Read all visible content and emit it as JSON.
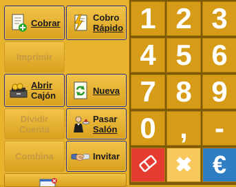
{
  "actions": {
    "cobrar": {
      "label": "Cobrar",
      "icon": "document-plus-icon"
    },
    "cobro_rapido": {
      "line1": "Cobro",
      "line2": "Rápido",
      "icon": "lightning-document-icon"
    },
    "imprimir": {
      "label": "Imprimir"
    },
    "abrir_cajon": {
      "line1": "Abrir",
      "line2": "Cajón",
      "icon": "cash-drawer-icon"
    },
    "nueva": {
      "label": "Nueva",
      "icon": "refresh-document-icon"
    },
    "dividir_cuenta": {
      "line1": "Dividir",
      "line2": "Cuenta"
    },
    "pasar_salon": {
      "line1": "Pasar",
      "line2": "Salón",
      "icon": "waiter-icon"
    },
    "combina": {
      "label": "Combina"
    },
    "invitar": {
      "label": "Invitar",
      "icon": "handshake-icon"
    }
  },
  "keypad": {
    "rows": [
      [
        "1",
        "2",
        "3"
      ],
      [
        "4",
        "5",
        "6"
      ],
      [
        "7",
        "8",
        "9"
      ],
      [
        "0",
        ",",
        "-"
      ]
    ],
    "erase_icon": "eraser-icon",
    "cancel_symbol": "✖",
    "currency_symbol": "€"
  },
  "colors": {
    "panel": "#e8b42e",
    "key": "#d69c17",
    "erase": "#e63b30",
    "cancel": "#f7c85b",
    "currency": "#2f7ec4"
  }
}
